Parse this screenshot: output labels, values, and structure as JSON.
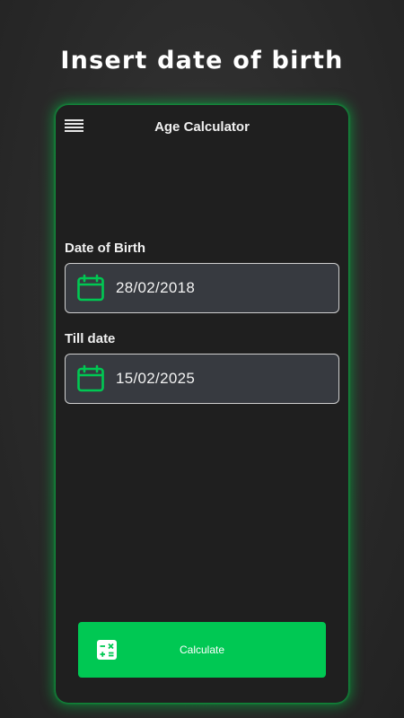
{
  "banner": {
    "headline": "Insert date of birth"
  },
  "app": {
    "title": "Age Calculator",
    "accent_color": "#00c853",
    "menu_icon": "hamburger-menu-icon"
  },
  "form": {
    "dob": {
      "label": "Date of Birth",
      "value": "28/02/2018",
      "icon": "calendar-icon"
    },
    "till": {
      "label": "Till date",
      "value": "15/02/2025",
      "icon": "calendar-icon"
    }
  },
  "actions": {
    "calculate_label": "Calculate",
    "calculate_icon": "calculator-icon"
  }
}
